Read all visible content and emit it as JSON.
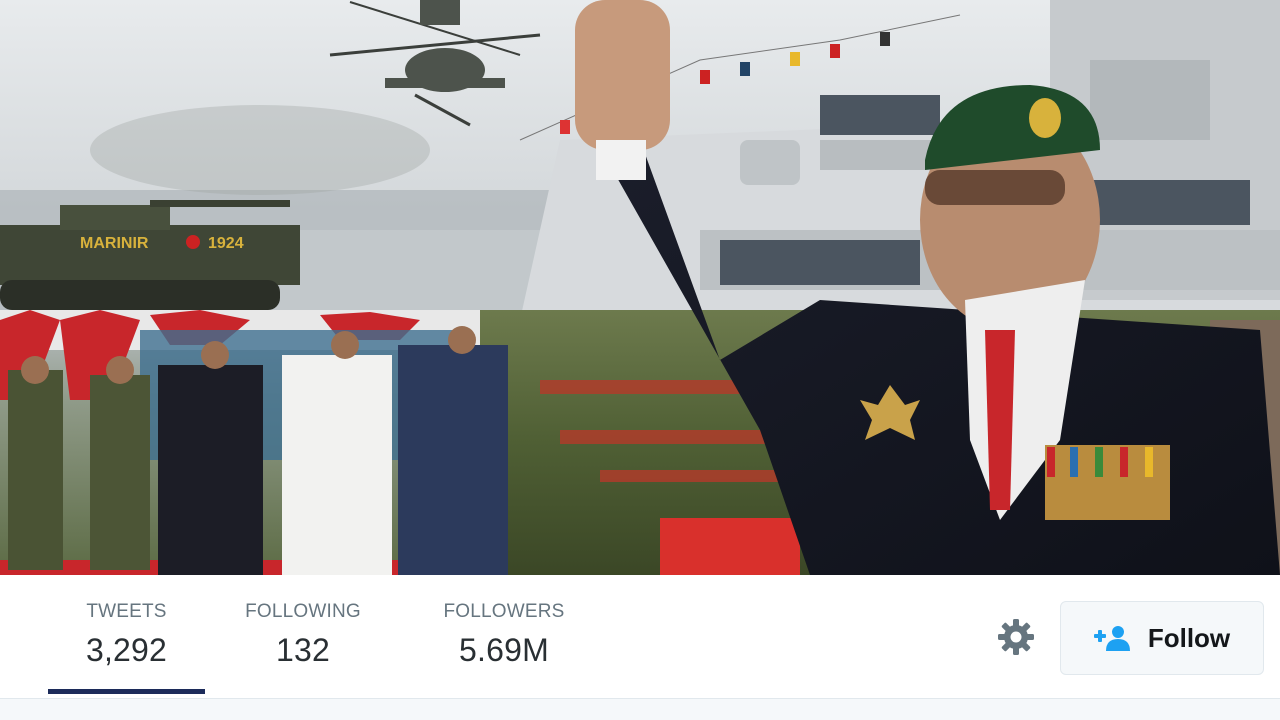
{
  "banner": {
    "tank_text": "MARINIR",
    "tank_number": "1924"
  },
  "profile_nav": {
    "stats": [
      {
        "label": "TWEETS",
        "value": "3,292",
        "active": true
      },
      {
        "label": "FOLLOWING",
        "value": "132",
        "active": false
      },
      {
        "label": "FOLLOWERS",
        "value": "5.69M",
        "active": false
      }
    ],
    "settings_icon": "gear-icon",
    "follow_button": {
      "label": "Follow",
      "icon": "add-user-icon"
    }
  },
  "colors": {
    "active_underline": "#1c2b5a",
    "follow_icon": "#1da1f2",
    "label_gray": "#66757f",
    "value_dark": "#292f33"
  }
}
